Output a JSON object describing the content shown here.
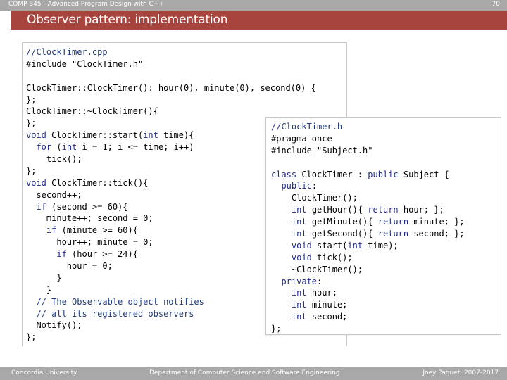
{
  "header": {
    "course": "COMP 345 - Advanced Program Design with C++",
    "page_number": "70",
    "title": "Observer pattern: implementation"
  },
  "left_code": [
    "//ClockTimer.cpp",
    "#include \"ClockTimer.h\"",
    "",
    "ClockTimer::ClockTimer(): hour(0), minute(0), second(0) {",
    "};",
    "ClockTimer::~ClockTimer(){",
    "};",
    "void ClockTimer::start(int time){",
    "  for (int i = 1; i <= time; i++)",
    "    tick();",
    "};",
    "void ClockTimer::tick(){",
    "  second++;",
    "  if (second >= 60){",
    "    minute++; second = 0;",
    "    if (minute >= 60){",
    "      hour++; minute = 0;",
    "      if (hour >= 24){",
    "        hour = 0;",
    "      }",
    "    }",
    "  // The Observable object notifies",
    "  // all its registered observers",
    "  Notify();",
    "};"
  ],
  "right_code": [
    "//ClockTimer.h",
    "#pragma once",
    "#include \"Subject.h\"",
    "",
    "class ClockTimer : public Subject {",
    "  public:",
    "    ClockTimer();",
    "    int getHour(){ return hour; };",
    "    int getMinute(){ return minute; };",
    "    int getSecond(){ return second; };",
    "    void start(int time);",
    "    void tick();",
    "    ~ClockTimer();",
    "  private:",
    "    int hour;",
    "    int minute;",
    "    int second;",
    "};"
  ],
  "footer": {
    "left": "Concordia University",
    "center": "Department of Computer Science and Software Engineering",
    "right": "Joey Paquet, 2007-2017"
  },
  "colors": {
    "title_bar": "#a7443d",
    "top_bar": "#a8a8a8",
    "keyword": "#1f2a8a"
  }
}
